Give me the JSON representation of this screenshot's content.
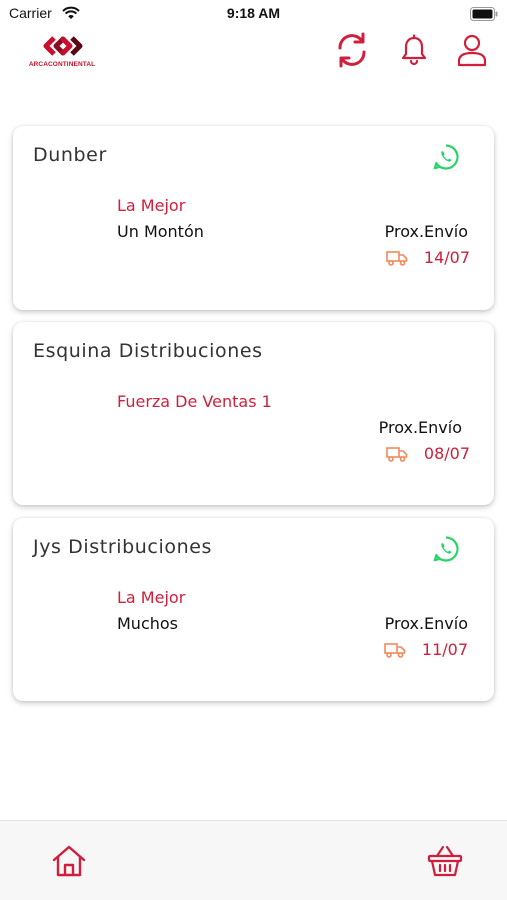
{
  "status_bar": {
    "carrier": "Carrier",
    "time": "9:18 AM"
  },
  "header": {
    "logo_text": "ARCACONTINENTAL",
    "icons": [
      "refresh-icon",
      "bell-icon",
      "user-icon"
    ]
  },
  "colors": {
    "brand_red": "#d01f3c",
    "whatsapp_green": "#25d366",
    "truck_orange": "#f08a5d"
  },
  "cards": [
    {
      "title": "Dunber",
      "has_whatsapp": true,
      "route": "La Mejor",
      "detail": "Un Montón",
      "next_label": "Prox.Envío",
      "next_date": "14/07"
    },
    {
      "title": "Esquina Distribuciones",
      "has_whatsapp": false,
      "route": "Fuerza De Ventas 1",
      "detail": "",
      "next_label": "Prox.Envío",
      "next_date": "08/07"
    },
    {
      "title": "Jys Distribuciones",
      "has_whatsapp": true,
      "route": "La Mejor",
      "detail": "Muchos",
      "next_label": "Prox.Envío",
      "next_date": "11/07"
    }
  ],
  "bottom_nav": {
    "items": [
      "home-icon",
      "basket-icon"
    ]
  }
}
